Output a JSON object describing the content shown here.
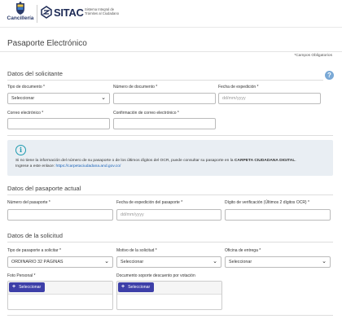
{
  "header": {
    "logo_text": "Cancillería",
    "brand": "SITAC",
    "brand_subtitle": "Sistema Integral de Trámites al Ciudadano"
  },
  "page": {
    "title": "Pasaporte Electrónico",
    "required_note": "*Campos Obligatorios"
  },
  "solicitante": {
    "title": "Datos del solicitante",
    "tipo_documento_label": "Tipo de documento *",
    "tipo_documento_value": "Seleccionar",
    "numero_documento_label": "Número de documento *",
    "numero_documento_value": "",
    "fecha_expedicion_label": "Fecha de expedición *",
    "fecha_expedicion_placeholder": "dd/mm/yyyy",
    "correo_label": "Correo electrónico *",
    "correo_value": "",
    "confirm_correo_label": "Confirmación de correo electrónico *",
    "confirm_correo_value": ""
  },
  "info": {
    "text_line1": "Si no tiene la información del número de su pasaporte o de los últimos dígitos del OCR, puede consultar su pasaporte en la ",
    "text_bold": "CARPETA CIUDADANA DIGITAL",
    "text_line1_end": ".",
    "text_line2": "Ingrese a este enlace: ",
    "link": "https://carpetaciudadana.and.gov.co/"
  },
  "pasaporte_actual": {
    "title": "Datos del pasaporte actual",
    "numero_label": "Número del pasaporte *",
    "numero_value": "",
    "fecha_label": "Fecha de expedición del pasaporte *",
    "fecha_placeholder": "dd/mm/yyyy",
    "ocr_label": "Dígito de verificación (Últimos 2 dígitos OCR) *",
    "ocr_value": ""
  },
  "solicitud": {
    "title": "Datos de la solicitud",
    "tipo_label": "Tipo de pasaporte a solicitar *",
    "tipo_value": "ORDINARIO 32 PÁGINAS",
    "motivo_label": "Motivo de la solicitud *",
    "motivo_value": "Seleccionar",
    "oficina_label": "Oficina de entrega *",
    "oficina_value": "Seleccionar",
    "foto_label": "Foto Personal *",
    "foto_button": "Seleccionar",
    "doc_label": "Documento soporte descuento por votación",
    "doc_button": "Seleccionar"
  },
  "icons": {
    "help": "question-circle",
    "info": "info-circle",
    "dropdown": "chevron-down",
    "add": "plus"
  },
  "colors": {
    "primary_button": "#3d3fa8",
    "info_icon": "#1f9bb0",
    "help_icon": "#7aa9d6",
    "link": "#1a62b8"
  }
}
